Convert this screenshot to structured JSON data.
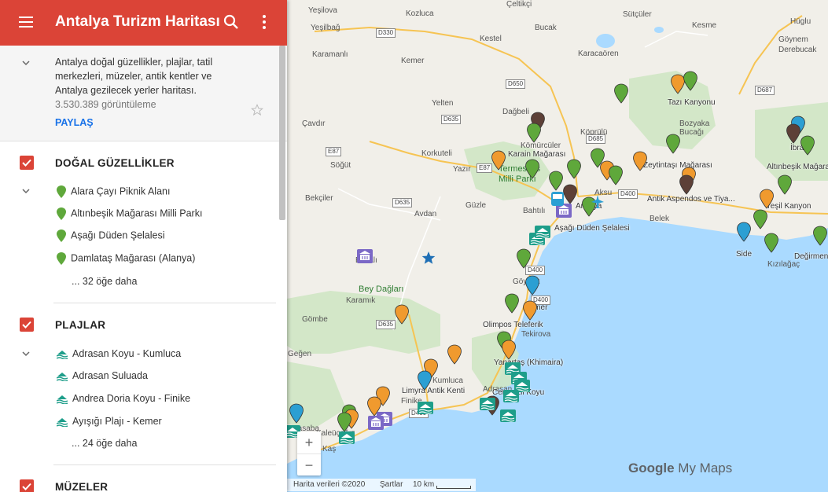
{
  "header": {
    "title": "Antalya Turizm Haritası",
    "menu_icon": "hamburger-menu-icon",
    "search_icon": "search-icon",
    "more_icon": "more-vert-icon",
    "color": "#db4437"
  },
  "description": {
    "text": "Antalya doğal güzellikler, plajlar, tatil merkezleri, müzeler, antik kentler ve Antalya gezilecek yerler haritası.",
    "views": "3.530.389 görüntüleme",
    "share": "PAYLAŞ"
  },
  "layers": [
    {
      "title": "DOĞAL GÜZELLİKLER",
      "icon": "green-marker-icon",
      "items": [
        "Alara Çayı Piknik Alanı",
        "Altınbeşik Mağarası Milli Parkı",
        "Aşağı Düden Şelalesi",
        "Damlataş Mağarası (Alanya)"
      ],
      "more": "... 32 öğe daha"
    },
    {
      "title": "PLAJLAR",
      "icon": "beach-icon",
      "items": [
        "Adrasan Koyu - Kumluca",
        "Adrasan Suluada",
        "Andrea Doria Koyu - Finike",
        "Ayışığı Plajı - Kemer"
      ],
      "more": "... 24 öğe daha"
    },
    {
      "title": "MÜZELER"
    }
  ],
  "map": {
    "places": [
      {
        "name": "Yeşilova",
        "style": ""
      },
      {
        "name": "Kozluca",
        "style": ""
      },
      {
        "name": "Çeltikçi",
        "style": ""
      },
      {
        "name": "Sütçüler",
        "style": ""
      },
      {
        "name": "Yeşilbağ",
        "style": ""
      },
      {
        "name": "Bucak",
        "style": ""
      },
      {
        "name": "Kesme",
        "style": ""
      },
      {
        "name": "Hüglu",
        "style": ""
      },
      {
        "name": "Kestel",
        "style": ""
      },
      {
        "name": "Göynem",
        "style": ""
      },
      {
        "name": "Karamanlı",
        "style": ""
      },
      {
        "name": "Kemer",
        "style": ""
      },
      {
        "name": "Karacaören",
        "style": ""
      },
      {
        "name": "Derebucak",
        "style": ""
      },
      {
        "name": "Yelten",
        "style": ""
      },
      {
        "name": "Dağbeli",
        "style": ""
      },
      {
        "name": "Tazı Kanyonu",
        "style": "dark"
      },
      {
        "name": "Çavdır",
        "style": ""
      },
      {
        "name": "Bozyaka",
        "style": ""
      },
      {
        "name": "Bucağı",
        "style": ""
      },
      {
        "name": "Köprülü",
        "style": ""
      },
      {
        "name": "Korkuteli",
        "style": ""
      },
      {
        "name": "Kömürcüler",
        "style": ""
      },
      {
        "name": "Karain Mağarası",
        "style": "dark"
      },
      {
        "name": "Söğüt",
        "style": ""
      },
      {
        "name": "Yazır",
        "style": ""
      },
      {
        "name": "Termessos",
        "style": "park"
      },
      {
        "name": "Milli Parkı",
        "style": "park"
      },
      {
        "name": "Zeytintaşı Mağarası",
        "style": "dark"
      },
      {
        "name": "Altınbeşik Mağarası",
        "style": "dark"
      },
      {
        "name": "İbradı",
        "style": "dark"
      },
      {
        "name": "Aksu",
        "style": ""
      },
      {
        "name": "Bekçiler",
        "style": ""
      },
      {
        "name": "Güzle",
        "style": ""
      },
      {
        "name": "Avdan",
        "style": ""
      },
      {
        "name": "Bahtılı",
        "style": ""
      },
      {
        "name": "Antalya",
        "style": "dark"
      },
      {
        "name": "Antik Aspendos ve Tiya...",
        "style": "dark"
      },
      {
        "name": "Yeşil Kanyon",
        "style": "dark"
      },
      {
        "name": "Belek",
        "style": ""
      },
      {
        "name": "Aşağı Düden Şelalesi",
        "style": "dark"
      },
      {
        "name": "Side",
        "style": "dark"
      },
      {
        "name": "Değirmendere",
        "style": "dark"
      },
      {
        "name": "Kızılağaç",
        "style": ""
      },
      {
        "name": "Elmalı",
        "style": ""
      },
      {
        "name": "Bey Dağları",
        "style": "park"
      },
      {
        "name": "Göynük",
        "style": ""
      },
      {
        "name": "Karamık",
        "style": ""
      },
      {
        "name": "Kemer",
        "style": "dark"
      },
      {
        "name": "Gömbe",
        "style": ""
      },
      {
        "name": "Olimpos Teleferik",
        "style": "dark"
      },
      {
        "name": "Tekirova",
        "style": ""
      },
      {
        "name": "Yanartaş (Khimaira)",
        "style": "dark"
      },
      {
        "name": "Geğen",
        "style": ""
      },
      {
        "name": "Kumluca",
        "style": ""
      },
      {
        "name": "Limyra Antik Kenti",
        "style": "dark"
      },
      {
        "name": "Adrasan",
        "style": ""
      },
      {
        "name": "Cenevizli Koyu",
        "style": "dark"
      },
      {
        "name": "Finike",
        "style": ""
      },
      {
        "name": "Kasaba",
        "style": ""
      },
      {
        "name": "Kaleüçağız",
        "style": ""
      },
      {
        "name": "Kaş",
        "style": ""
      }
    ],
    "roads": [
      "D330",
      "D650",
      "D635",
      "D685",
      "D687",
      "E87",
      "E87",
      "D635",
      "D400",
      "D400",
      "D635",
      "D400",
      "D400"
    ],
    "zoom_in": "+",
    "zoom_out": "−",
    "footer": {
      "data": "Harita verileri ©2020",
      "terms": "Şartlar",
      "scale": "10 km"
    },
    "logo_google": "Google",
    "logo_mymaps": "My Maps",
    "colors": {
      "sea": "#aadaff",
      "land": "#f1efe9",
      "park": "#cfe5c4",
      "green_marker": "#5fa83b",
      "orange_marker": "#f09a2e",
      "blue_marker": "#2b9fd3",
      "brown_marker": "#5d4037",
      "purple": "#7b68c6",
      "teal": "#1e9e8a"
    }
  }
}
